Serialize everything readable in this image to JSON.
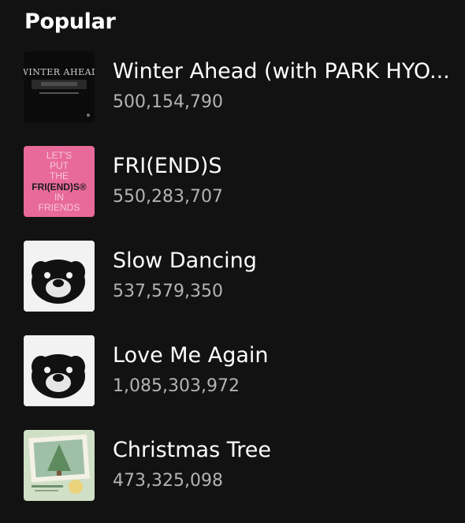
{
  "section": {
    "title": "Popular"
  },
  "tracks": [
    {
      "title": "Winter Ahead (with PARK HYO...",
      "plays": "500,154,790",
      "cover_text": "WINTER AHEAD",
      "cover_icon": "winter-ahead-cover"
    },
    {
      "title": "FRI(END)S",
      "plays": "550,283,707",
      "cover_lines": [
        "LET'S",
        "PUT",
        "THE",
        "FRI(END)S®",
        "IN",
        "FRIENDS"
      ],
      "cover_icon": "friends-cover"
    },
    {
      "title": "Slow Dancing",
      "plays": "537,579,350",
      "cover_icon": "layover-cover"
    },
    {
      "title": "Love Me Again",
      "plays": "1,085,303,972",
      "cover_icon": "layover-cover"
    },
    {
      "title": "Christmas Tree",
      "plays": "473,325,098",
      "cover_icon": "christmas-tree-cover"
    }
  ],
  "colors": {
    "background": "#121212",
    "primary_text": "#ffffff",
    "secondary_text": "#b3b3b3",
    "friends_pink": "#e86a9a"
  }
}
